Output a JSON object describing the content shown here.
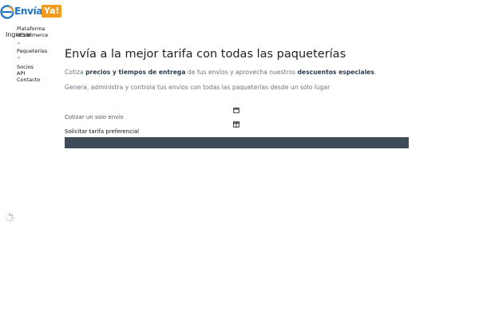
{
  "brand": {
    "name": "Envía",
    "badge": "Ya!",
    "colors": {
      "primary": "#1a73c8",
      "accent": "#f39a21",
      "bar": "#3d4b58"
    }
  },
  "header": {
    "login_label": "Ingresar"
  },
  "nav": {
    "items": [
      {
        "label": "Plataforma eCommerce",
        "has_submenu": true
      },
      {
        "label": "Paqueterías",
        "has_submenu": true
      },
      {
        "label": "Socios"
      },
      {
        "label": "API"
      },
      {
        "label": "Contacto"
      }
    ]
  },
  "hero": {
    "title": "Envía a la mejor tarifa con todas las paqueterías",
    "line1_pre": "Cotiza ",
    "line1_b1": "precios y tiempos de entrega",
    "line1_mid": " de tus envíos y aprovecha nuestros ",
    "line1_b2": "descuentos especiales",
    "line1_end": ".",
    "line2": "Genera, administra y controla tus envíos con todas las paqueterías desde un solo lugar"
  },
  "actions": {
    "quote_single": "Cotizar un solo envío",
    "preferential_rate": "Solicitar tarifa preferencial",
    "icons": [
      "package-icon",
      "package-box-icon"
    ]
  }
}
